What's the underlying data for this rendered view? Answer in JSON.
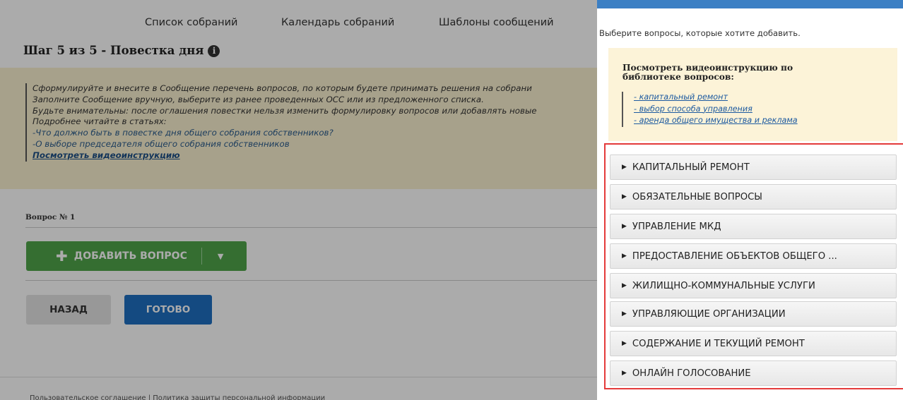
{
  "nav": {
    "items": [
      "Список собраний",
      "Календарь собраний",
      "Шаблоны сообщений"
    ]
  },
  "step": {
    "title": "Шаг 5 из 5 - Повестка дня",
    "info_icon": "i"
  },
  "notice": {
    "lines": [
      "Сформулируйте и внесите в Сообщение перечень вопросов, по которым будете принимать решения на собрани",
      "Заполните Сообщение вручную, выберите из ранее проведенных ОСС или из предложенного списка.",
      "Будьте внимательны: после оглашения повестки нельзя изменить формулировку вопросов или добавлять новые",
      "Подробнее читайте в статьях:"
    ],
    "link1": "-Что должно быть в повестке дня общего собрания собственников?",
    "link2": "-О выборе председателя общего собрания собственников",
    "video_link": "Посмотреть видеоинструкцию"
  },
  "question": {
    "label": "Вопрос № 1"
  },
  "buttons": {
    "add_question": "ДОБАВИТЬ ВОПРОС",
    "back": "НАЗАД",
    "done": "ГОТОВО"
  },
  "footer": {
    "text": "Пользовательское соглашение  |  Политика защиты персональной информации"
  },
  "panel": {
    "subtitle": "Выберите вопросы, которые хотите добавить.",
    "video_title": "Посмотреть видеоинструкцию по библиотеке вопросов:",
    "video_links": [
      "- капитальный ремонт ",
      "- выбор способа управления ",
      "- аренда общего имущества и реклама"
    ],
    "categories": [
      "КАПИТАЛЬНЫЙ РЕМОНТ",
      "ОБЯЗАТЕЛЬНЫЕ ВОПРОСЫ",
      "УПРАВЛЕНИЕ МКД",
      "ПРЕДОСТАВЛЕНИЕ ОБЪЕКТОВ ОБЩЕГО ...",
      "ЖИЛИЩНО-КОММУНАЛЬНЫЕ УСЛУГИ",
      "УПРАВЛЯЮЩИЕ ОРГАНИЗАЦИИ",
      "СОДЕРЖАНИЕ И ТЕКУЩИЙ РЕМОНТ",
      "ОНЛАЙН ГОЛОСОВАНИЕ"
    ]
  },
  "colors": {
    "add_button": "#4fa54a",
    "done_button": "#1f6fc0",
    "panel_header": "#3b7fc4",
    "highlight_frame": "#e43a3a",
    "notice_bg": "#faf0cf"
  }
}
